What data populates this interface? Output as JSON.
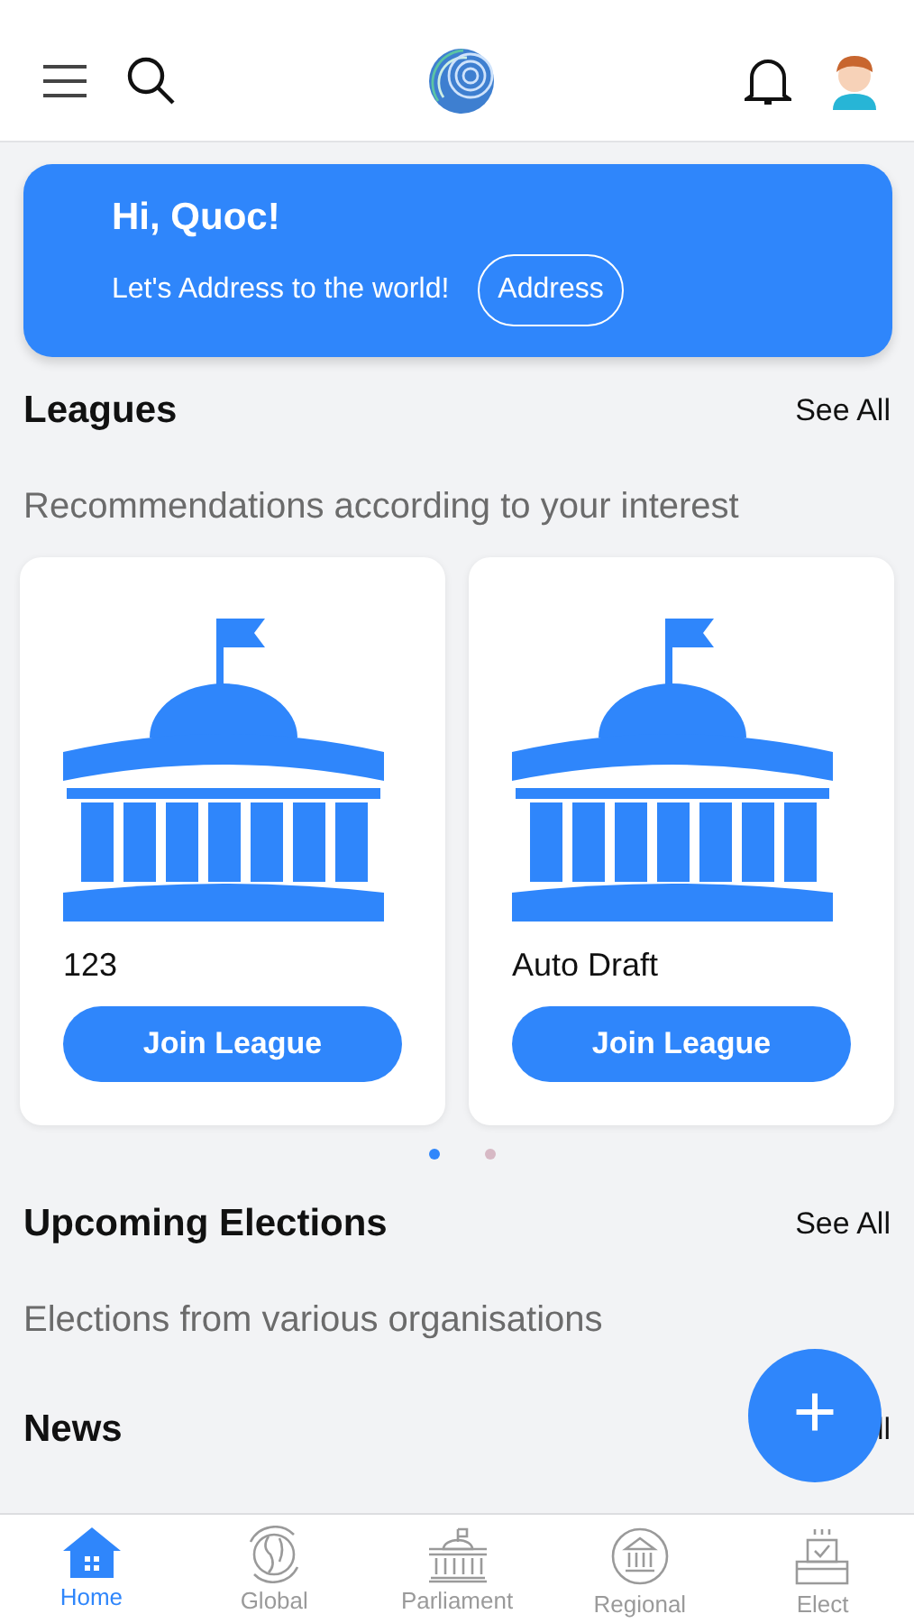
{
  "header": {
    "kind": "home"
  },
  "banner": {
    "greeting": "Hi, Quoc!",
    "message": "Let's Address to the world!",
    "button": "Address"
  },
  "leagues": {
    "title": "Leagues",
    "see_all": "See All",
    "subtitle": "Recommendations according to your interest",
    "cards": [
      {
        "name": "123",
        "button": "Join League"
      },
      {
        "name": "Auto Draft",
        "button": "Join League"
      }
    ],
    "pages": [
      {
        "selected": true
      },
      {
        "selected": false
      }
    ]
  },
  "elections": {
    "title": "Upcoming Elections",
    "see_all": "See All",
    "subtitle": "Elections from various organisations"
  },
  "news": {
    "title": "News",
    "see_all": "ll"
  },
  "fab": {
    "label": "+"
  },
  "tabs": [
    {
      "label": "Home",
      "kind": "home",
      "selected": true
    },
    {
      "label": "Global",
      "kind": "global",
      "selected": false
    },
    {
      "label": "Parliament",
      "kind": "parliament",
      "selected": false
    },
    {
      "label": "Regional",
      "kind": "regional",
      "selected": false
    },
    {
      "label": "Elect",
      "kind": "elect",
      "selected": false
    }
  ]
}
